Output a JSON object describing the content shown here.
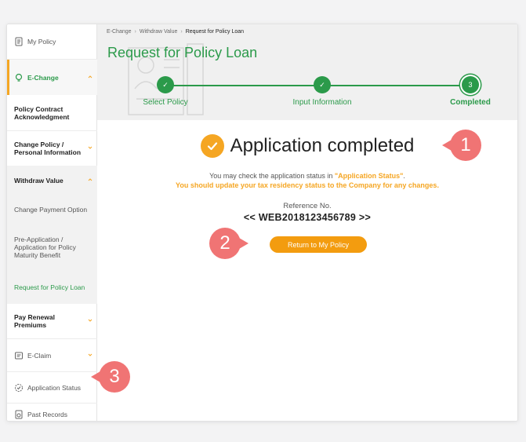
{
  "breadcrumb": [
    "E-Change",
    "Withdraw Value",
    "Request for Policy Loan"
  ],
  "page_title": "Request for Policy Loan",
  "steps": [
    {
      "label": "Select Policy",
      "mark": "✓"
    },
    {
      "label": "Input Information",
      "mark": "✓"
    },
    {
      "label": "Completed",
      "mark": "3"
    }
  ],
  "sidebar": {
    "my_policy": "My Policy",
    "e_change": "E-Change",
    "policy_contract": "Policy Contract Acknowledgment",
    "change_policy": "Change Policy / Personal Information",
    "withdraw_value": "Withdraw Value",
    "change_payment": "Change Payment Option",
    "pre_application": "Pre-Application / Application for Policy Maturity Benefit",
    "request_loan": "Request for Policy Loan",
    "pay_renewal": "Pay Renewal Premiums",
    "e_claim": "E-Claim",
    "application_status": "Application Status",
    "past_records": "Past Records"
  },
  "result": {
    "heading": "Application completed",
    "msg_prefix": "You may check the application status in ",
    "msg_link": "\"Application Status\"",
    "msg_suffix": ".",
    "msg_warning": "You should update your tax residency status to the Company for any changes.",
    "reference_label": "Reference No.",
    "reference_no": "<< WEB2018123456789 >>",
    "return_button": "Return to My Policy"
  },
  "callouts": [
    "1",
    "2",
    "3"
  ],
  "colors": {
    "green": "#2b9a4a",
    "orange": "#f5a623",
    "callout": "#f07474"
  }
}
